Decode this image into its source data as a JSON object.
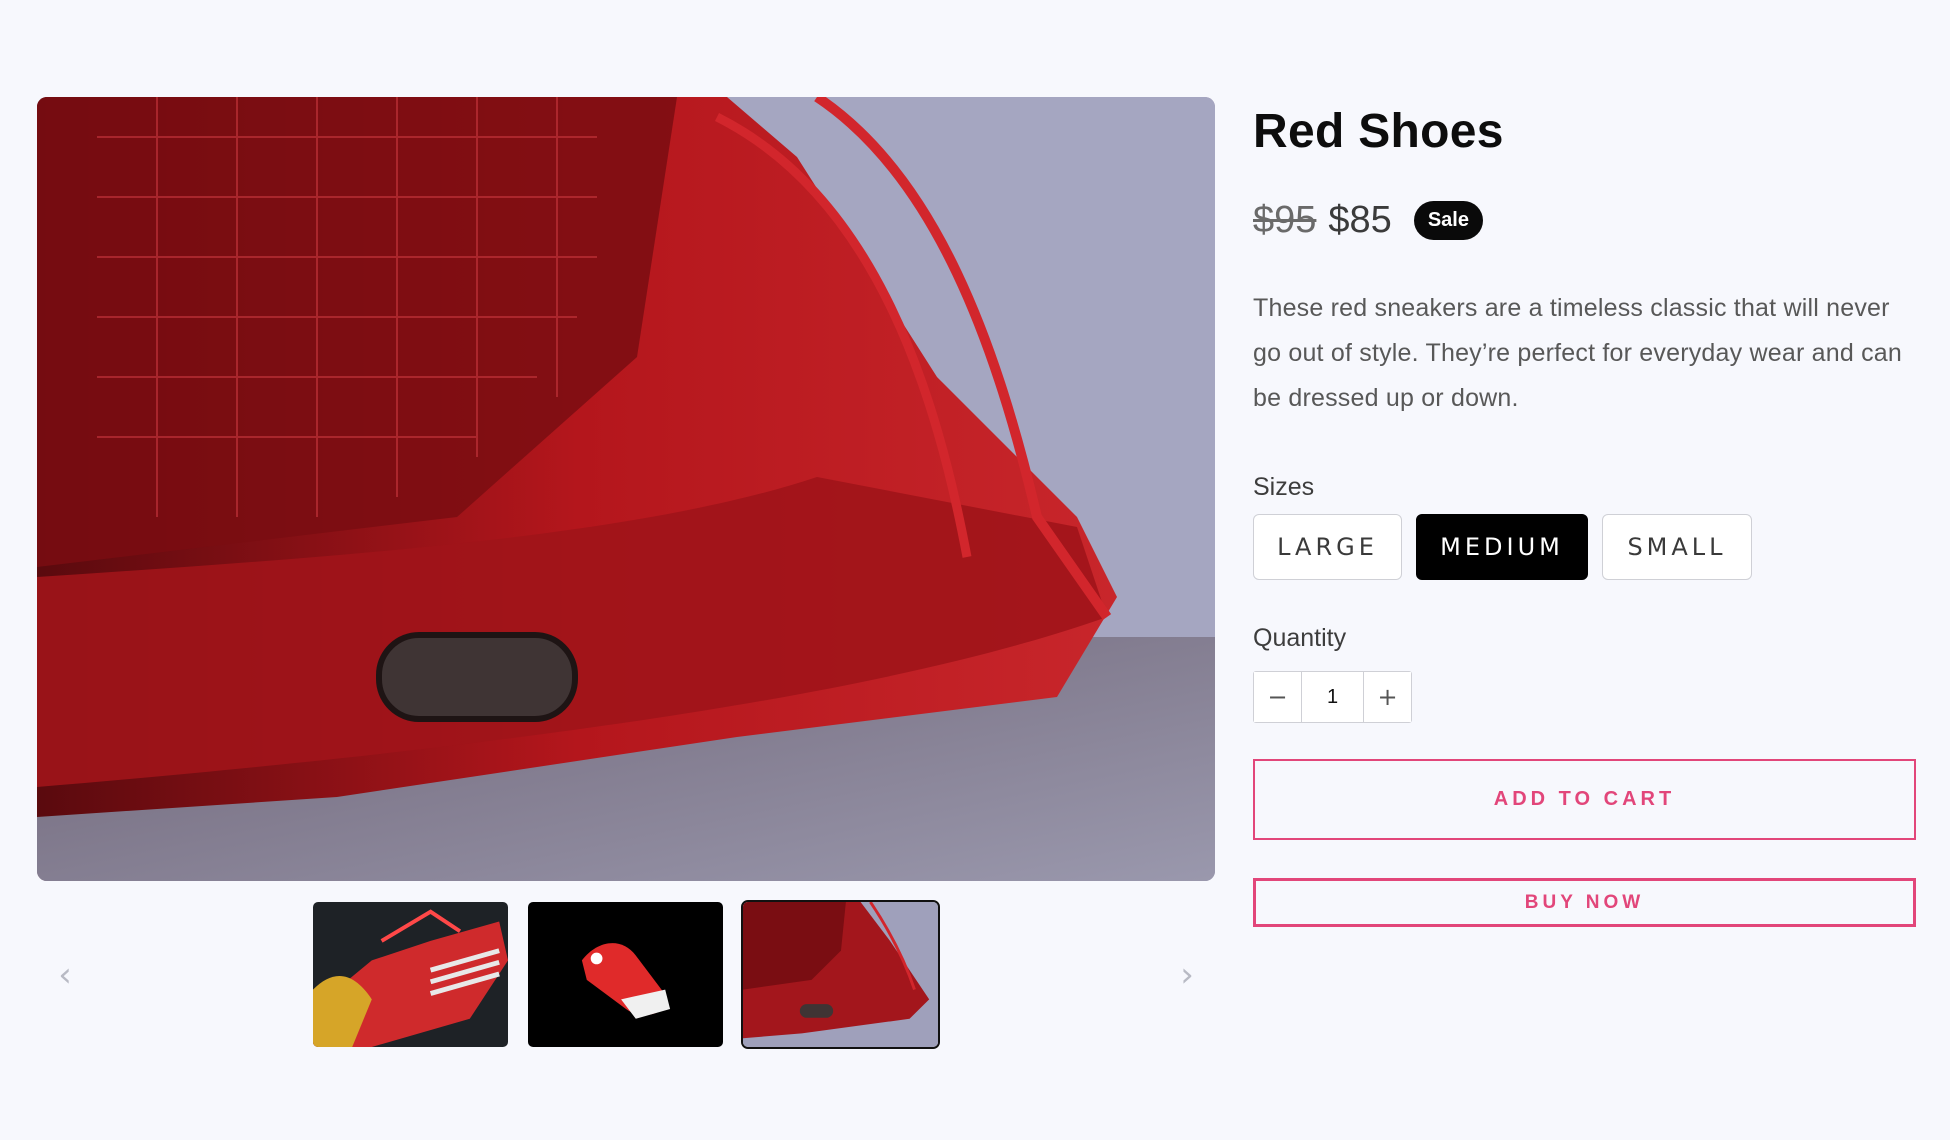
{
  "gallery": {
    "main_image_alt": "Close-up of a red sneaker",
    "prev_icon": "chevron-left-icon",
    "next_icon": "chevron-right-icon",
    "thumbnails": [
      {
        "alt": "Red suede sneakers with white stripes"
      },
      {
        "alt": "Red sneaker on black background"
      },
      {
        "alt": "Close-up of red sneaker",
        "active": true
      }
    ]
  },
  "product": {
    "title": "Red Shoes",
    "price_original": "$95",
    "price_sale": "$85",
    "badge": "Sale",
    "description": "These red sneakers are a timeless classic that will never go out of style. They’re perfect for everyday wear and can be dressed up or down."
  },
  "sizes": {
    "label": "Sizes",
    "options": [
      "LARGE",
      "MEDIUM",
      "SMALL"
    ],
    "selected": "MEDIUM"
  },
  "quantity": {
    "label": "Quantity",
    "value": "1",
    "decrement": "−",
    "increment": "+"
  },
  "actions": {
    "add_to_cart": "ADD TO CART",
    "buy_now": "BUY NOW"
  },
  "colors": {
    "accent": "#e2467a",
    "background": "#f7f8fd",
    "selected_size_bg": "#000000"
  }
}
